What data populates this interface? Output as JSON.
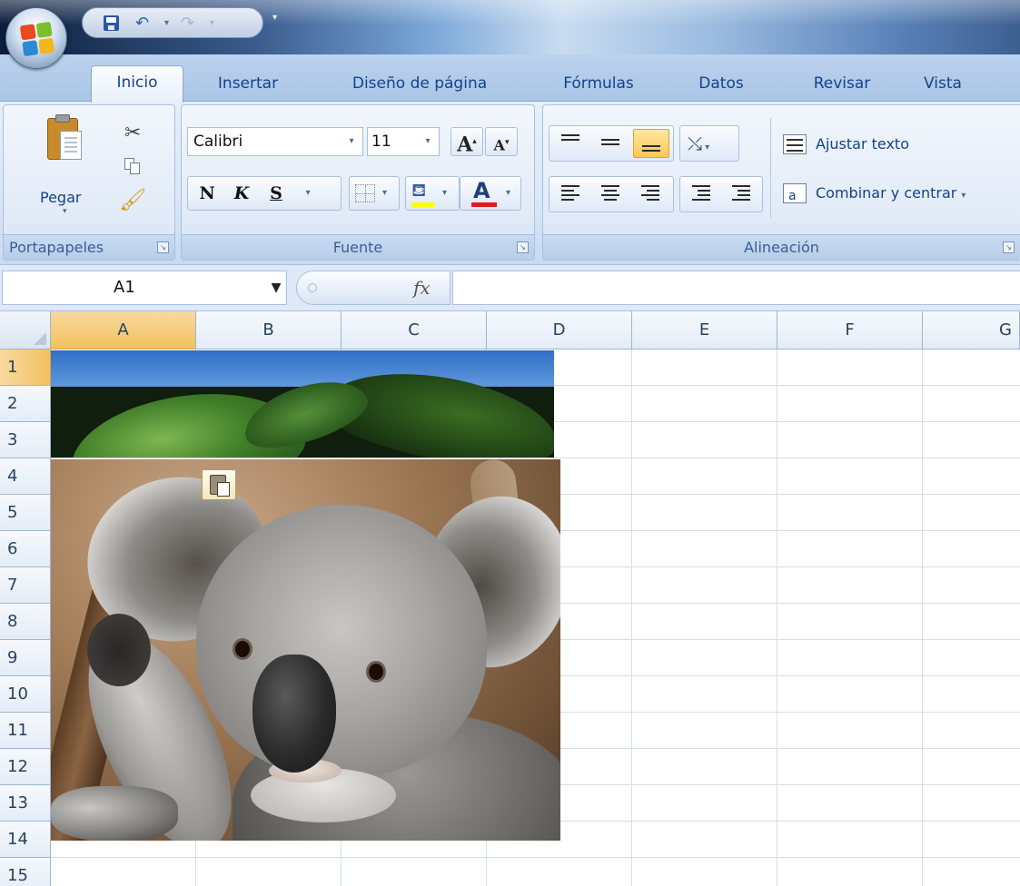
{
  "title_bar": {
    "quick_access": [
      "save",
      "undo",
      "redo"
    ]
  },
  "tabs": [
    {
      "label": "Inicio",
      "active": true
    },
    {
      "label": "Insertar",
      "active": false
    },
    {
      "label": "Diseño de página",
      "active": false
    },
    {
      "label": "Fórmulas",
      "active": false
    },
    {
      "label": "Datos",
      "active": false
    },
    {
      "label": "Revisar",
      "active": false
    },
    {
      "label": "Vista",
      "active": false
    }
  ],
  "ribbon": {
    "clipboard": {
      "group_label": "Portapapeles",
      "paste_label": "Pegar",
      "icons": [
        "paste-icon",
        "cut-icon",
        "copy-icon",
        "format-painter-icon"
      ]
    },
    "font": {
      "group_label": "Fuente",
      "font_name": "Calibri",
      "font_size": "11",
      "bold": "N",
      "italic": "K",
      "underline": "S",
      "grow": "A",
      "shrink": "A",
      "font_color_letter": "A",
      "fill_color": "#ffff00",
      "font_color": "#e31b1b"
    },
    "alignment": {
      "group_label": "Alineación",
      "wrap_text": "Ajustar texto",
      "merge_center": "Combinar y centrar",
      "active_vertical_align": "bottom"
    }
  },
  "formula_bar": {
    "name_box": "A1",
    "fx_label": "fx",
    "formula": ""
  },
  "grid": {
    "columns": [
      "A",
      "B",
      "C",
      "D",
      "E",
      "F",
      "G"
    ],
    "rows": [
      "1",
      "2",
      "3",
      "4",
      "5",
      "6",
      "7",
      "8",
      "9",
      "10",
      "11",
      "12",
      "13",
      "14",
      "15"
    ],
    "selected_cell": "A1",
    "selected_column": "A",
    "selected_row": "1"
  },
  "pasted_images": [
    "sky-leaves-image",
    "koala-image"
  ],
  "accent_colors": {
    "ribbon_blue": "#15428b",
    "selected_header": "#f1c15f",
    "active_button": "#ffc754"
  }
}
